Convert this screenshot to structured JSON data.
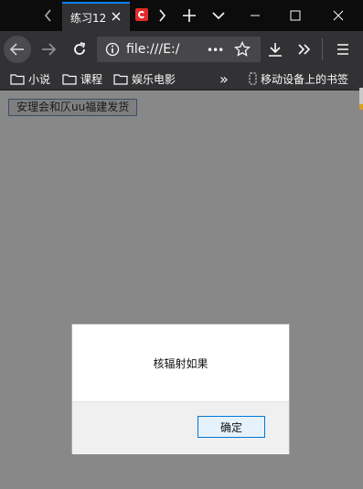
{
  "tabs": {
    "active_title": "练习12",
    "accent": "#0a84ff"
  },
  "navbar": {
    "url_text": "file:///E:/",
    "more_label": "•••"
  },
  "bookmarks": {
    "items": [
      {
        "label": "小说",
        "icon": "folder-icon"
      },
      {
        "label": "课程",
        "icon": "folder-icon"
      },
      {
        "label": "娱乐电影",
        "icon": "folder-icon"
      }
    ],
    "overflow_label": "»",
    "mobile_label": "移动设备上的书签"
  },
  "page": {
    "button_label": "安理会和仄uu福建发货"
  },
  "dialog": {
    "message": "核辐射如果",
    "ok_label": "确定"
  }
}
